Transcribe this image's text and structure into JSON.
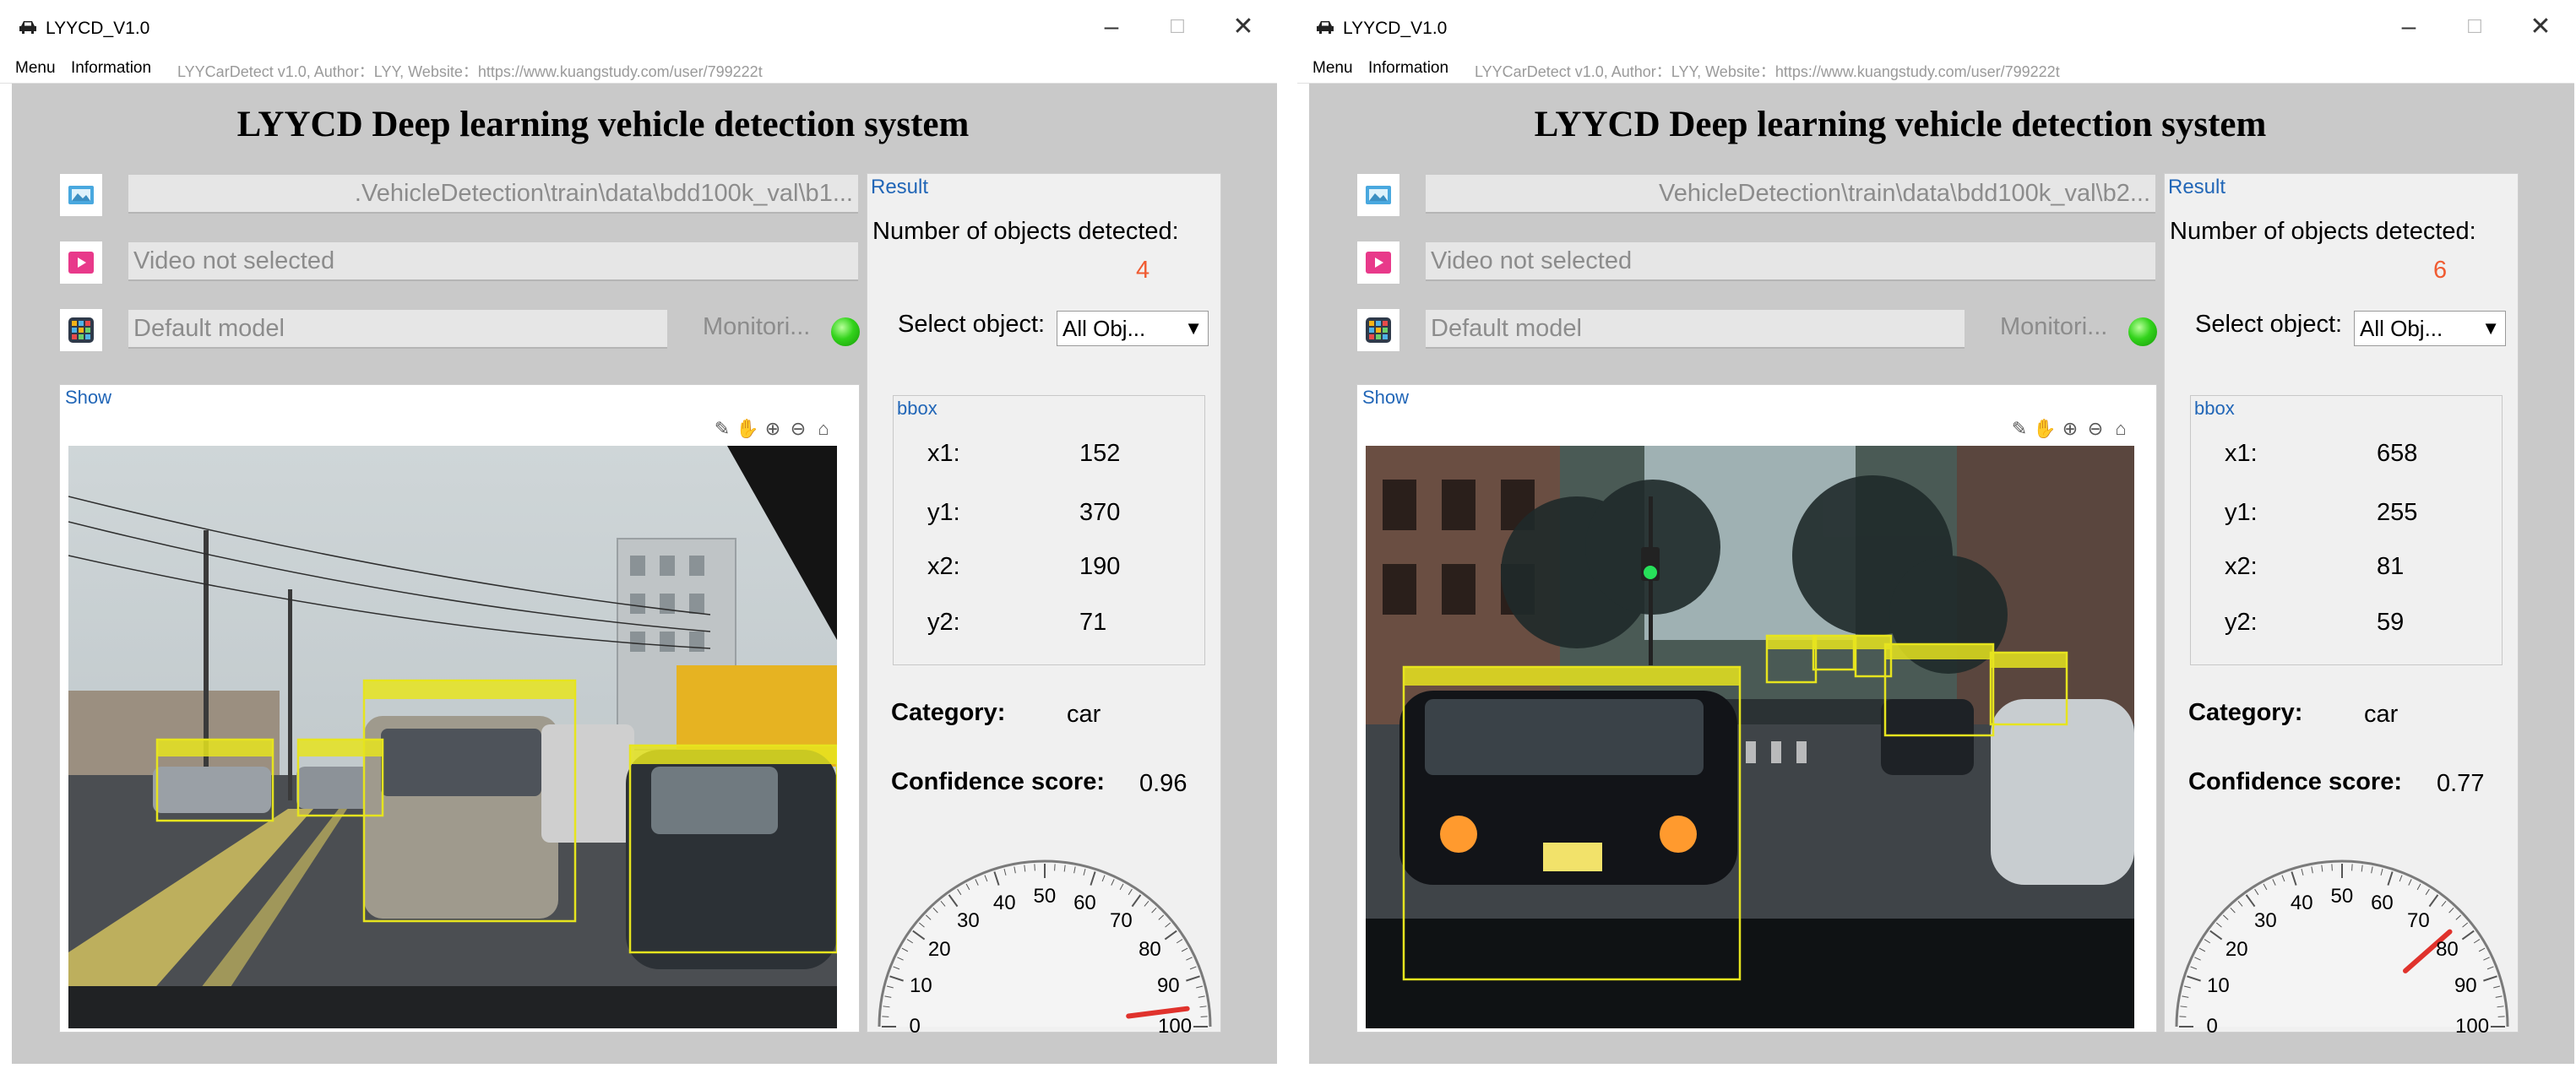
{
  "windows": [
    {
      "title": "LYYCD_V1.0",
      "menu": [
        "Menu",
        "Information"
      ],
      "info_text": "LYYCarDetect v1.0, Author：LYY, Website：https://www.kuangstudy.com/user/799222t",
      "heading": "LYYCD Deep learning vehicle detection system",
      "image_path": ".VehicleDetection\\train\\data\\bdd100k_val\\b1...",
      "video_path": "Video not selected",
      "model_path": "Default model",
      "monitor_label": "Monitori...",
      "show_title": "Show",
      "result_title": "Result",
      "num_label": "Number of objects detected:",
      "num_value": "4",
      "select_label": "Select object:",
      "select_value": "All Obj...",
      "bbox_title": "bbox",
      "bbox_keys": [
        "x1:",
        "y1:",
        "x2:",
        "y2:"
      ],
      "bbox_values": [
        "152",
        "370",
        "190",
        "71"
      ],
      "category_label": "Category:",
      "category_value": "car",
      "confidence_label": "Confidence score:",
      "confidence_value": "0.96",
      "gauge_ticks": [
        "0",
        "10",
        "20",
        "30",
        "40",
        "50",
        "60",
        "70",
        "80",
        "90",
        "100"
      ],
      "gauge_value": 96,
      "detections": [
        {
          "label": "car"
        },
        {
          "label": "car"
        },
        {
          "label": "car"
        },
        {
          "label": "car"
        }
      ]
    },
    {
      "title": "LYYCD_V1.0",
      "menu": [
        "Menu",
        "Information"
      ],
      "info_text": "LYYCarDetect v1.0, Author：LYY, Website：https://www.kuangstudy.com/user/799222t",
      "heading": "LYYCD Deep learning vehicle detection system",
      "image_path": "VehicleDetection\\train\\data\\bdd100k_val\\b2...",
      "video_path": "Video not selected",
      "model_path": "Default model",
      "monitor_label": "Monitori...",
      "show_title": "Show",
      "result_title": "Result",
      "num_label": "Number of objects detected:",
      "num_value": "6",
      "select_label": "Select object:",
      "select_value": "All Obj...",
      "bbox_title": "bbox",
      "bbox_keys": [
        "x1:",
        "y1:",
        "x2:",
        "y2:"
      ],
      "bbox_values": [
        "658",
        "255",
        "81",
        "59"
      ],
      "category_label": "Category:",
      "category_value": "car",
      "confidence_label": "Confidence score:",
      "confidence_value": "0.77",
      "gauge_ticks": [
        "0",
        "10",
        "20",
        "30",
        "40",
        "50",
        "60",
        "70",
        "80",
        "90",
        "100"
      ],
      "gauge_value": 77,
      "detections": [
        {
          "label": "car"
        },
        {
          "label": "car"
        },
        {
          "label": "car"
        },
        {
          "label": "car"
        },
        {
          "label": "car"
        },
        {
          "label": "car"
        }
      ]
    }
  ],
  "colors": {
    "accent_blue": "#2166b7",
    "count_orange": "#f05b31",
    "box_yellow": "#e6e41e",
    "needle_red": "#e0322c",
    "status_green": "#33d31c"
  }
}
